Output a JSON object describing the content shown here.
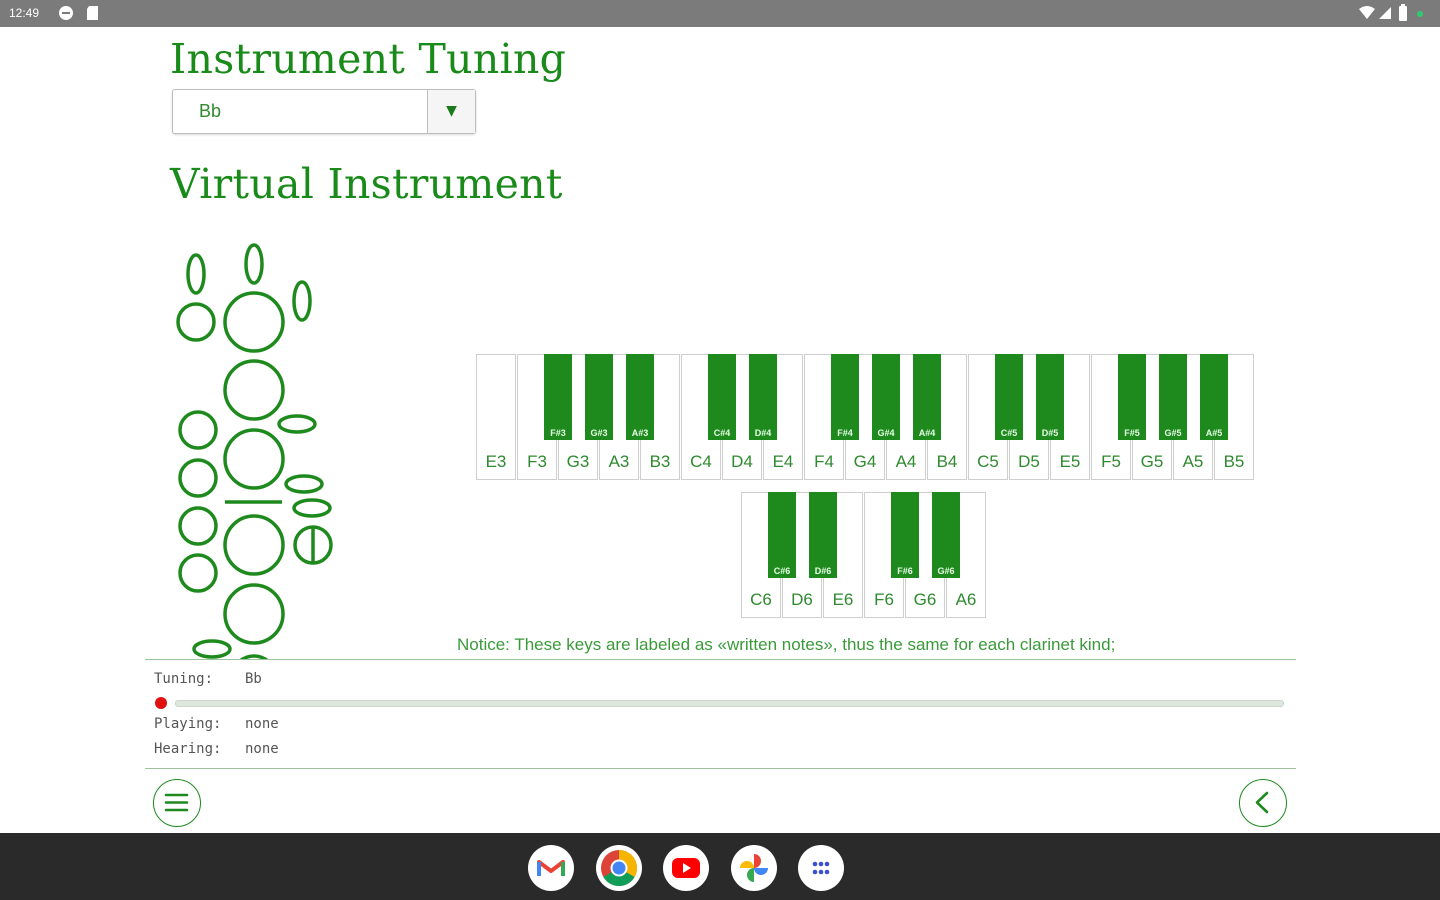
{
  "status_bar": {
    "time": "12:49",
    "icons": [
      "blocked-icon",
      "sd-card-icon",
      "wifi-icon",
      "signal-icon",
      "battery-icon",
      "dot-indicator-icon"
    ]
  },
  "headings": {
    "tuning": "Instrument Tuning",
    "virtual": "Virtual Instrument"
  },
  "tuning_select": {
    "value": "Bb",
    "arrow": "▼"
  },
  "keyboard_row1": {
    "white_keys": [
      "E3",
      "F3",
      "G3",
      "A3",
      "B3",
      "C4",
      "D4",
      "E4",
      "F4",
      "G4",
      "A4",
      "B4",
      "C5",
      "D5",
      "E5",
      "F5",
      "G5",
      "A5",
      "B5"
    ],
    "black_keys": [
      "F#3",
      "G#3",
      "A#3",
      "C#4",
      "D#4",
      "F#4",
      "G#4",
      "A#4",
      "C#5",
      "D#5",
      "F#5",
      "G#5",
      "A#5"
    ]
  },
  "keyboard_row2": {
    "white_keys": [
      "C6",
      "D6",
      "E6",
      "F6",
      "G6",
      "A6"
    ],
    "black_keys": [
      "C#6",
      "D#6",
      "F#6",
      "G#6"
    ]
  },
  "notice": "Notice: These keys are labeled as «written notes», thus the same for each clarinet kind;",
  "status_panel": {
    "tuning_label": "Tuning:",
    "tuning_value": "Bb",
    "playing_label": "Playing:",
    "playing_value": "none",
    "hearing_label": "Hearing:",
    "hearing_value": "none",
    "progress": 0
  },
  "colors": {
    "accent": "#1e8a1e",
    "text_green": "#2f8a2f",
    "progress_dot": "#e01010",
    "statusbar": "#7b7b7b",
    "navbar": "#2a2a2a"
  },
  "bottom_bar": {
    "menu_icon": "hamburger-menu-icon",
    "back_icon": "chevron-left-icon"
  },
  "dock": [
    "gmail-icon",
    "chrome-icon",
    "youtube-icon",
    "photos-icon",
    "app-drawer-icon"
  ]
}
